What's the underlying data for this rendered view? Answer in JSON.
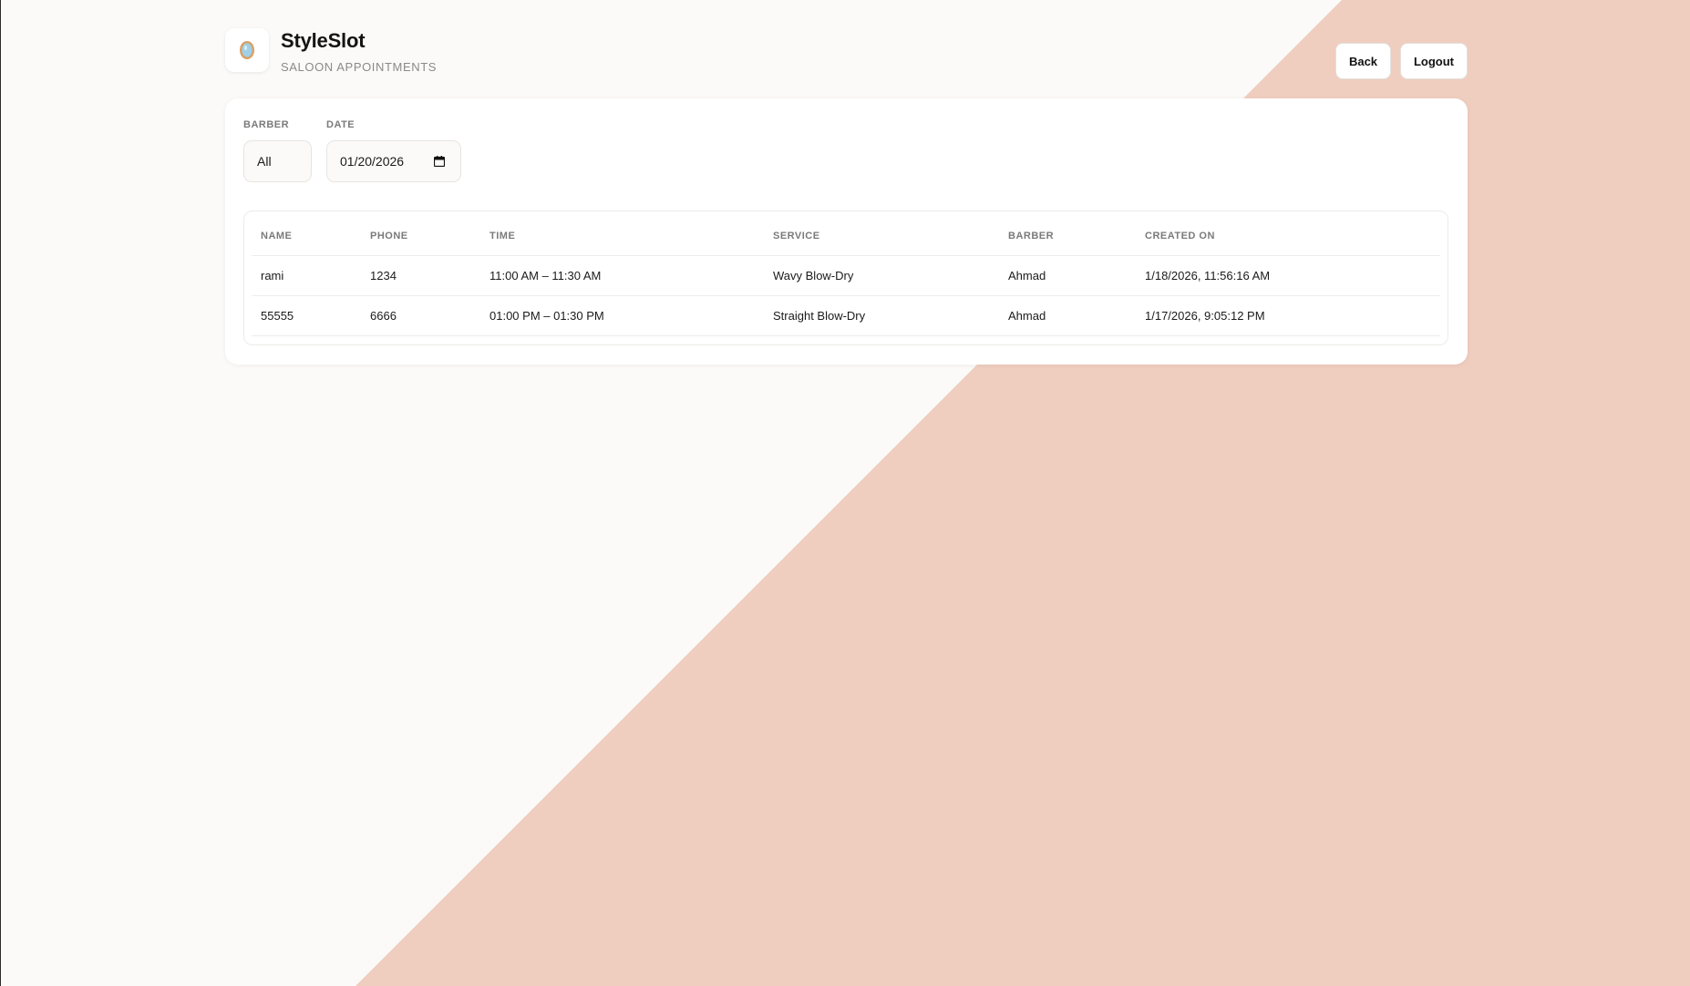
{
  "app": {
    "title": "StyleSlot",
    "subtitle": "SALOON APPOINTMENTS",
    "logo_icon": "mirror-icon"
  },
  "nav": {
    "back_label": "Back",
    "logout_label": "Logout"
  },
  "filters": {
    "barber": {
      "label": "BARBER",
      "value": "All"
    },
    "date": {
      "label": "DATE",
      "value": "01/20/2026"
    }
  },
  "table": {
    "headers": {
      "name": "NAME",
      "phone": "PHONE",
      "time": "TIME",
      "service": "SERVICE",
      "barber": "BARBER",
      "created_on": "CREATED ON"
    },
    "rows": [
      {
        "name": "rami",
        "phone": "1234",
        "time": "11:00 AM – 11:30 AM",
        "service": "Wavy Blow-Dry",
        "barber": "Ahmad",
        "created_on": "1/18/2026, 11:56:16 AM"
      },
      {
        "name": "55555",
        "phone": "6666",
        "time": "01:00 PM – 01:30 PM",
        "service": "Straight Blow-Dry",
        "barber": "Ahmad",
        "created_on": "1/17/2026, 9:05:12 PM"
      }
    ]
  },
  "colors": {
    "background": "#fbfaf8",
    "accent_diagonal": "#efcdbf",
    "card": "#ffffff"
  }
}
